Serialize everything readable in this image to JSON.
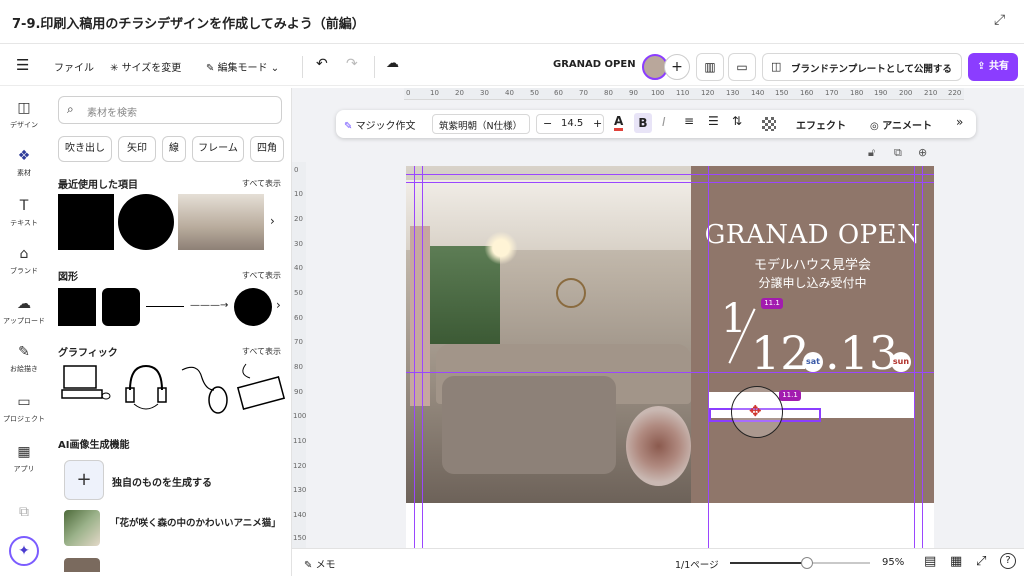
{
  "title": "7-9.印刷入稿用のチラシデザインを作成してみよう（前編）",
  "toolbar": {
    "file": "ファイル",
    "resize": "サイズを変更",
    "edit_mode": "編集モード",
    "doc_name": "GRANAD OPEN",
    "publish_template": "ブランドテンプレートとして公開する",
    "share": "共有"
  },
  "rail": [
    {
      "label": "デザイン"
    },
    {
      "label": "素材"
    },
    {
      "label": "テキスト"
    },
    {
      "label": "ブランド"
    },
    {
      "label": "アップロード"
    },
    {
      "label": "お絵描き"
    },
    {
      "label": "プロジェクト"
    },
    {
      "label": "アプリ"
    }
  ],
  "panel": {
    "search_placeholder": "素材を検索",
    "chips": [
      "吹き出し",
      "矢印",
      "線",
      "フレーム",
      "四角"
    ],
    "recent_title": "最近使用した項目",
    "shapes_title": "図形",
    "graphics_title": "グラフィック",
    "see_all": "すべて表示",
    "ai_title": "AI画像生成機能",
    "ai_generate": "独自のものを生成する",
    "ai_example": "「花が咲く森の中のかわいいアニメ猫」"
  },
  "context_bar": {
    "magic_write": "マジック作文",
    "font": "筑紫明朝（N仕様）",
    "font_size": "14.5",
    "effects": "エフェクト",
    "animate": "アニメート"
  },
  "ruler_h": [
    "0",
    "10",
    "20",
    "30",
    "40",
    "50",
    "60",
    "70",
    "80",
    "90",
    "100",
    "110",
    "120",
    "130",
    "140",
    "150",
    "160",
    "170",
    "180",
    "190",
    "200",
    "210",
    "220"
  ],
  "ruler_v": [
    "0",
    "10",
    "20",
    "30",
    "40",
    "50",
    "60",
    "70",
    "80",
    "90",
    "100",
    "110",
    "120",
    "130",
    "140",
    "150"
  ],
  "flyer": {
    "headline": "GRANAD OPEN",
    "sub1": "モデルハウス見学会",
    "sub2": "分譲申し込み受付中",
    "month": "1",
    "day1": "12",
    "dow1": "sat",
    "day2": ".13",
    "dow2": "sun",
    "badge1": "11.1",
    "badge2": "11.1"
  },
  "bottom": {
    "notes": "メモ",
    "pages": "1/1ページ",
    "zoom": "95%",
    "zoom_level": 0.55
  },
  "colors": {
    "accent": "#8b3dff",
    "flyer_panel": "#8f766a",
    "sat": "#3a5aa8",
    "sun": "#b0302a"
  }
}
